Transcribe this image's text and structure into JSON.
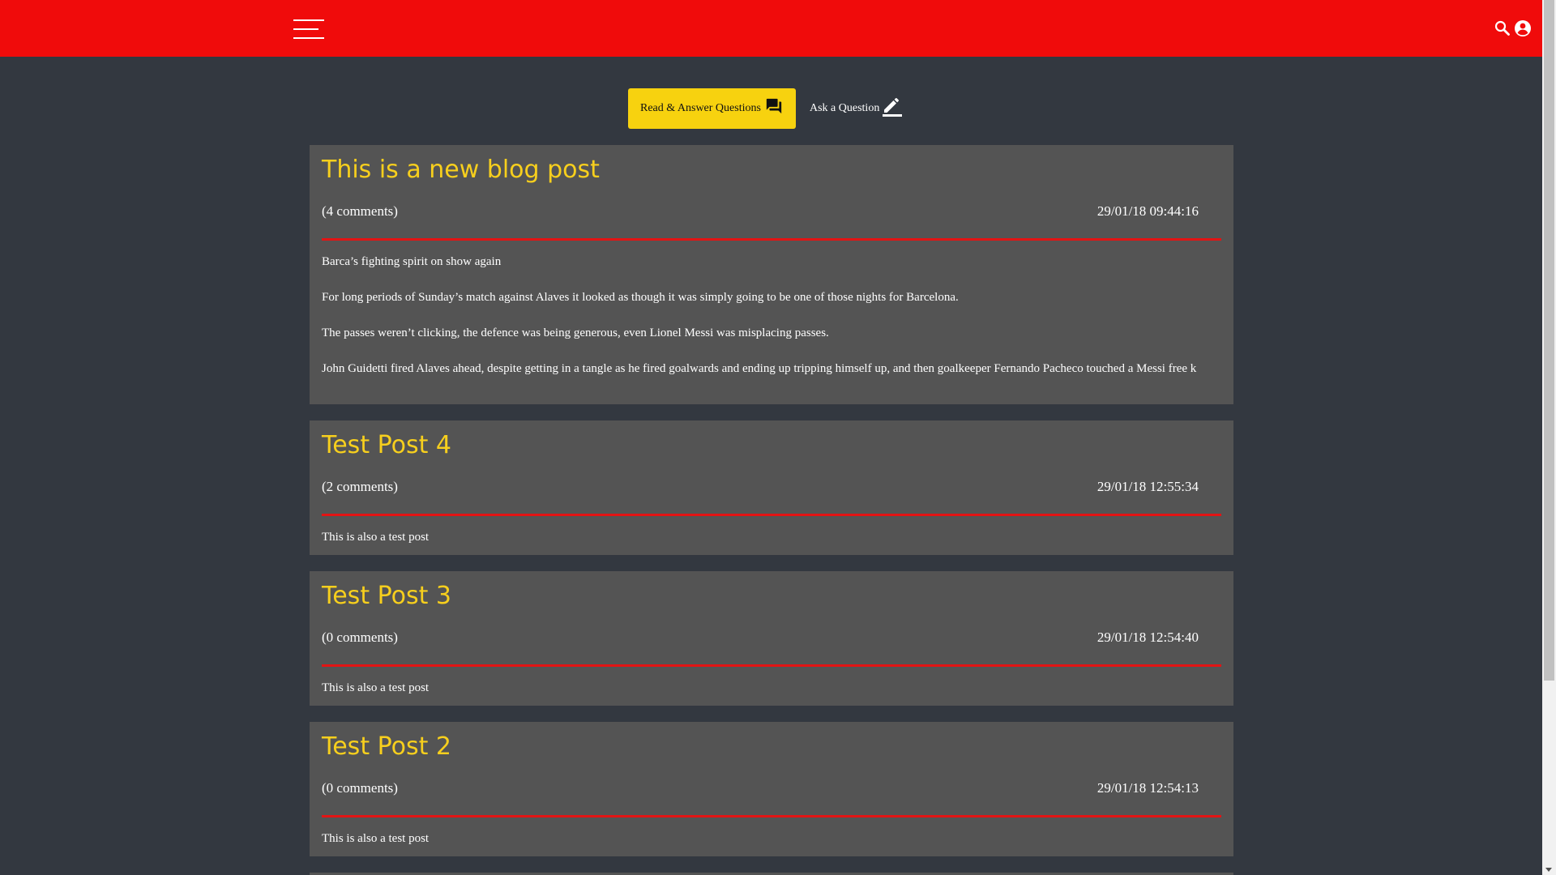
{
  "header": {
    "menu_icon": "hamburger-menu-icon",
    "search_icon": "search-icon",
    "account_icon": "account-circle-icon",
    "bar_color": "#f00b0b"
  },
  "actions": {
    "read_answer_label": "Read & Answer Questions",
    "read_answer_icon": "forum-icon",
    "read_answer_color": "#f7d20f",
    "ask_label": "Ask a Question",
    "ask_icon": "pencil-icon"
  },
  "posts": [
    {
      "title": "This is a new blog post",
      "comments": "(4 comments)",
      "date": "29/01/18 09:44:16",
      "paragraphs": [
        "Barca’s fighting spirit on show again",
        "For long periods of Sunday’s match against Alaves it looked as though it was simply going to be one of those nights for Barcelona.",
        "The passes weren’t clicking, the defence was being generous, even Lionel Messi was misplacing passes.",
        "John Guidetti fired Alaves ahead, despite getting in a tangle as he fired goalwards and ending up tripping himself up, and then goalkeeper Fernando Pacheco touched a Messi free k"
      ]
    },
    {
      "title": "Test Post 4",
      "comments": "(2 comments)",
      "date": "29/01/18 12:55:34",
      "paragraphs": [
        "This is also a test post"
      ]
    },
    {
      "title": "Test Post 3",
      "comments": "(0 comments)",
      "date": "29/01/18 12:54:40",
      "paragraphs": [
        "This is also a test post"
      ]
    },
    {
      "title": "Test Post 2",
      "comments": "(0 comments)",
      "date": "29/01/18 12:54:13",
      "paragraphs": [
        "This is also a test post"
      ]
    }
  ],
  "colors": {
    "background": "#333840",
    "card": "#545454",
    "title": "#f7cf1d",
    "divider": "#e31414"
  }
}
